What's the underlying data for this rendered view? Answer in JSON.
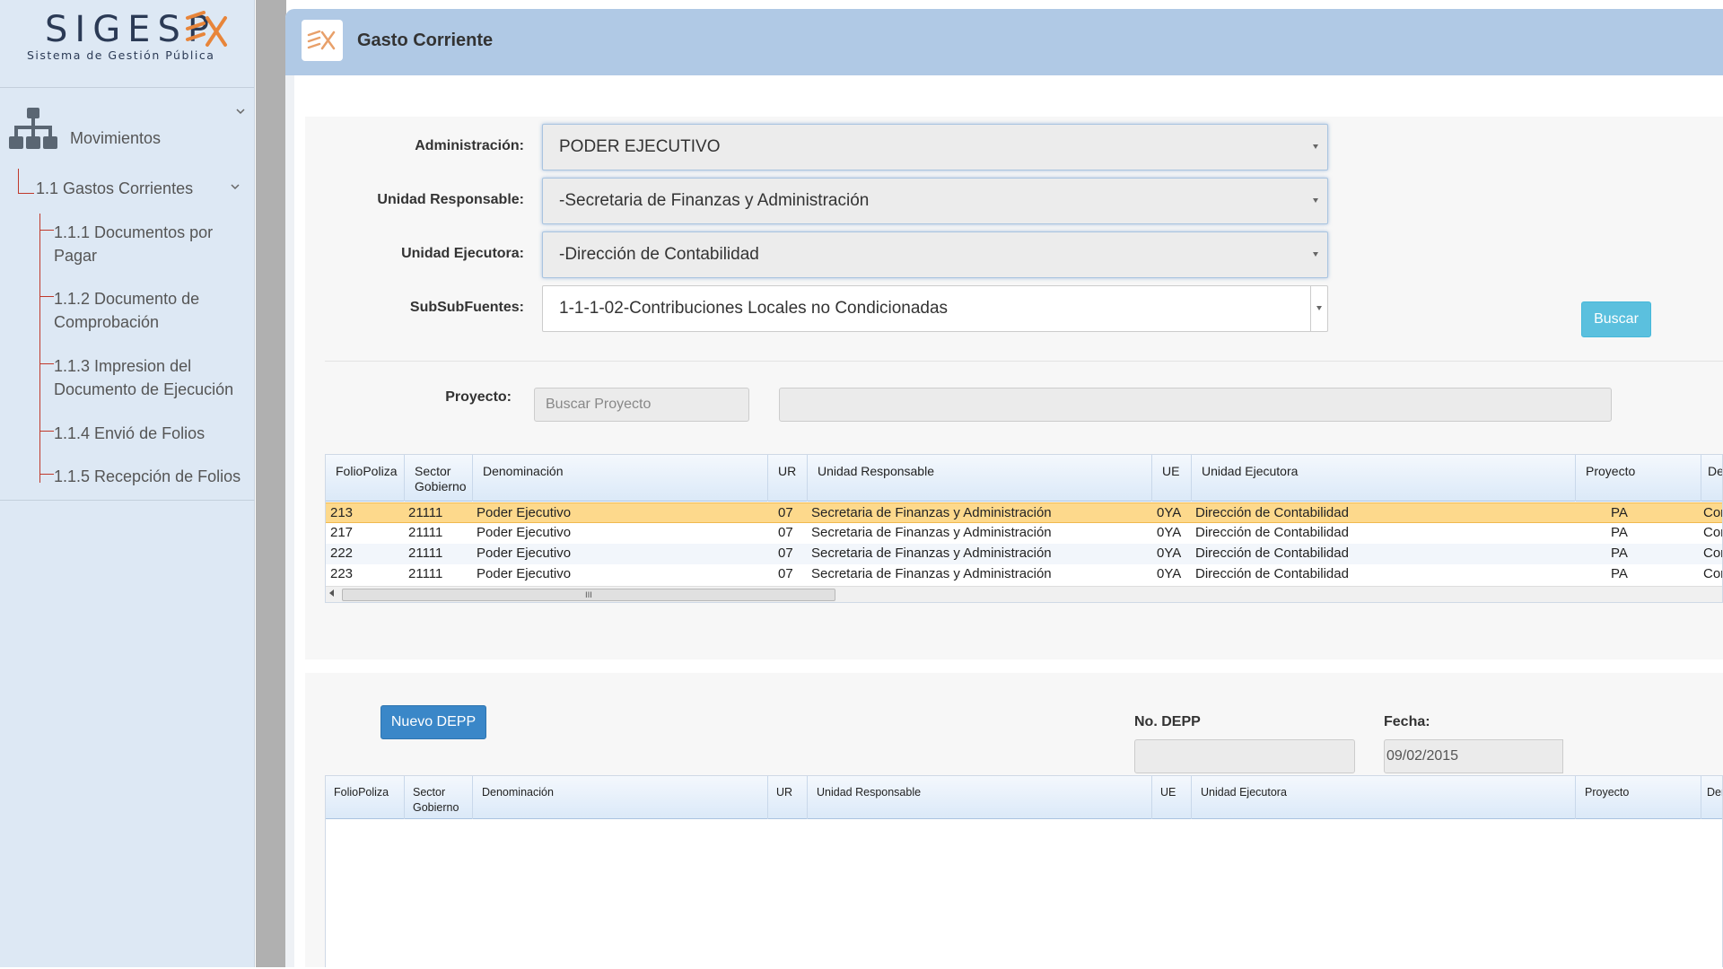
{
  "app": {
    "logo_text": "SIGESP",
    "logo_subtitle": "Sistema de Gestión Pública"
  },
  "sidebar": {
    "group_label": "Movimientos",
    "section_label": "1.1 Gastos Corrientes",
    "items": [
      {
        "label": "1.1.1 Documentos por Pagar"
      },
      {
        "label": "1.1.2 Documento de Comprobación"
      },
      {
        "label": "1.1.3 Impresion del Documento de Ejecución"
      },
      {
        "label": "1.1.4 Envió de Folios"
      },
      {
        "label": "1.1.5 Recepción de Folios"
      }
    ]
  },
  "header": {
    "title": "Gasto Corriente"
  },
  "filters": {
    "administracion": {
      "label": "Administración:",
      "value": "PODER EJECUTIVO"
    },
    "unidad_responsable": {
      "label": "Unidad Responsable:",
      "value": "-Secretaria de Finanzas y Administración"
    },
    "unidad_ejecutora": {
      "label": "Unidad Ejecutora:",
      "value": "-Dirección de Contabilidad"
    },
    "subsubfuentes": {
      "label": "SubSubFuentes:",
      "value": "1-1-1-02-Contribuciones Locales no Condicionadas"
    },
    "buscar_label": "Buscar",
    "proyecto_label": "Proyecto:",
    "proyecto_placeholder": "Buscar Proyecto"
  },
  "grid_top": {
    "columns": {
      "foliopoliza": "FolioPoliza",
      "sector": "Sector Gobierno",
      "denominacion": "Denominación",
      "ur": "UR",
      "unidad_responsable": "Unidad Responsable",
      "ue": "UE",
      "unidad_ejecutora": "Unidad Ejecutora",
      "proyecto": "Proyecto",
      "denom2": "Deno"
    },
    "rows": [
      {
        "folio": "213",
        "sector": "21111",
        "denom": "Poder Ejecutivo",
        "ur": "07",
        "uresp": "Secretaria de Finanzas y Administración",
        "ue": "0YA",
        "uejec": "Dirección de Contabilidad",
        "proy": "PA",
        "extra": "Conta",
        "selected": true
      },
      {
        "folio": "217",
        "sector": "21111",
        "denom": "Poder Ejecutivo",
        "ur": "07",
        "uresp": "Secretaria de Finanzas y Administración",
        "ue": "0YA",
        "uejec": "Dirección de Contabilidad",
        "proy": "PA",
        "extra": "Conta"
      },
      {
        "folio": "222",
        "sector": "21111",
        "denom": "Poder Ejecutivo",
        "ur": "07",
        "uresp": "Secretaria de Finanzas y Administración",
        "ue": "0YA",
        "uejec": "Dirección de Contabilidad",
        "proy": "PA",
        "extra": "Conta"
      },
      {
        "folio": "223",
        "sector": "21111",
        "denom": "Poder Ejecutivo",
        "ur": "07",
        "uresp": "Secretaria de Finanzas y Administración",
        "ue": "0YA",
        "uejec": "Dirección de Contabilidad",
        "proy": "PA",
        "extra": "Conta"
      }
    ],
    "scroll_grip": "III"
  },
  "depp": {
    "nuevo_label": "Nuevo DEPP",
    "no_depp_label": "No. DEPP",
    "fecha_label": "Fecha:",
    "fecha_value": "09/02/2015"
  },
  "grid_bottom": {
    "columns": {
      "foliopoliza": "FolioPoliza",
      "sector": "Sector Gobierno",
      "denominacion": "Denominación",
      "ur": "UR",
      "unidad_responsable": "Unidad Responsable",
      "ue": "UE",
      "unidad_ejecutora": "Unidad Ejecutora",
      "proyecto": "Proyecto",
      "denom2": "Denom"
    }
  },
  "colors": {
    "accent": "#e8853a",
    "header_bg": "#b0c9e5",
    "selected_row": "#fdd98c",
    "buscar_btn": "#5bc0de",
    "nuevo_btn": "#3a87c8",
    "tree_line": "#c0392b"
  }
}
